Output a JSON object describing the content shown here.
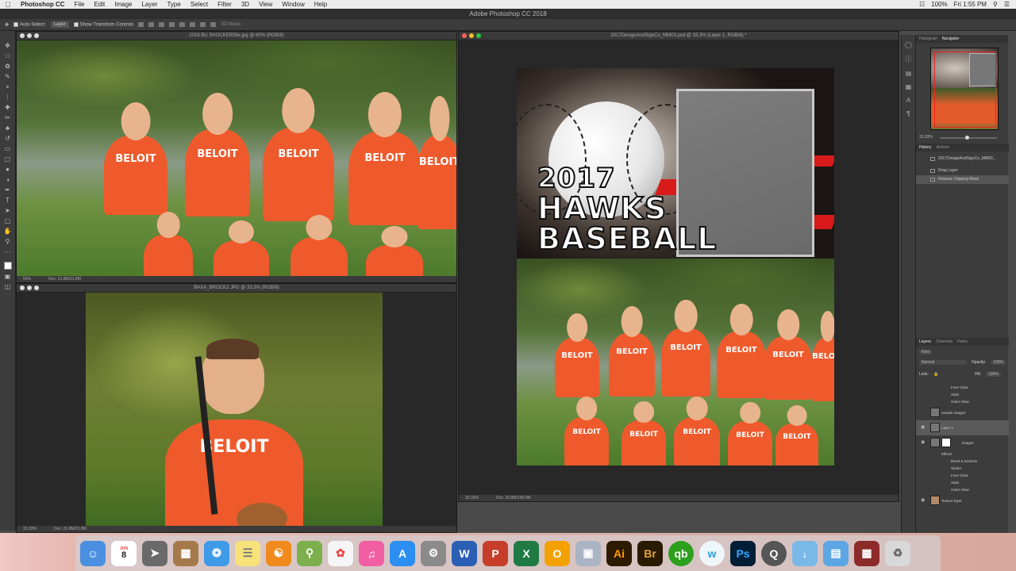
{
  "menubar": {
    "app_name": "Photoshop CC",
    "items": [
      "File",
      "Edit",
      "Image",
      "Layer",
      "Type",
      "Select",
      "Filter",
      "3D",
      "View",
      "Window",
      "Help"
    ],
    "window_title": "Adobe Photoshop CC 2018",
    "battery": "100%",
    "clock": "Fri 1:55 PM"
  },
  "options": {
    "auto_select_label": "Auto-Select:",
    "auto_select_value": "Layer",
    "show_transform_label": "Show Transform Controls",
    "mode_3d": "3D Mode:"
  },
  "doc1": {
    "title": "2018 BU SHOCKER59e.jpg @ 60% (RGB/8)",
    "zoom": "60%",
    "docsize": "Doc: 21.8M/21.8M",
    "jersey": "BELOIT"
  },
  "doc2": {
    "title": "BAXA_BROCK2.JPG @ 33.3% (RGB/8)",
    "zoom": "33.33%",
    "docsize": "Doc: 21.8M/21.8M",
    "jersey": "BELOIT"
  },
  "doc3": {
    "title": "2017DesignAndSignCo_MM03.psd @ 33.3% (Layer 1, RGB/8) *",
    "zoom": "33.33%",
    "docsize": "Doc: 20.8M/140.0M",
    "title_line1": "2017",
    "title_line2": "HAWKS",
    "title_line3": "BASEBALL",
    "jersey": "BELOIT"
  },
  "navigator": {
    "tabs": [
      "Histogram",
      "Navigator"
    ],
    "active": "Navigator",
    "zoom": "33.33%"
  },
  "history": {
    "tabs": [
      "History",
      "Actions"
    ],
    "snapshot": "2017DesignAndSignCo_MM03...",
    "items": [
      "Drag Layer",
      "Release Clipping Mask"
    ]
  },
  "layers": {
    "tabs": [
      "Layers",
      "Channels",
      "Paths"
    ],
    "kind": "Kind",
    "blend": "Normal",
    "opacity_label": "Opacity:",
    "opacity": "100%",
    "lock_label": "Lock:",
    "fill_label": "Fill:",
    "fill": "100%",
    "rows": {
      "inner_glow_a": "Inner Glow",
      "satin_a": "Satin",
      "outer_glow_a": "Outer Glow",
      "sample": "sample image2",
      "layer1": "Layer 1",
      "image2": "image2",
      "effects": "Effects",
      "bevel": "Bevel & Emboss",
      "stroke": "Stroke",
      "inner_glow_b": "Inner Glow",
      "satin_b": "Satin",
      "outer_glow_b": "Outer Glow",
      "texture": "Texture layer"
    }
  },
  "dock": {
    "cal_month": "JUN",
    "cal_day": "8",
    "word": "W",
    "excel": "X",
    "ai": "Ai",
    "br": "Br",
    "qb": "qb",
    "ps": "Ps"
  }
}
